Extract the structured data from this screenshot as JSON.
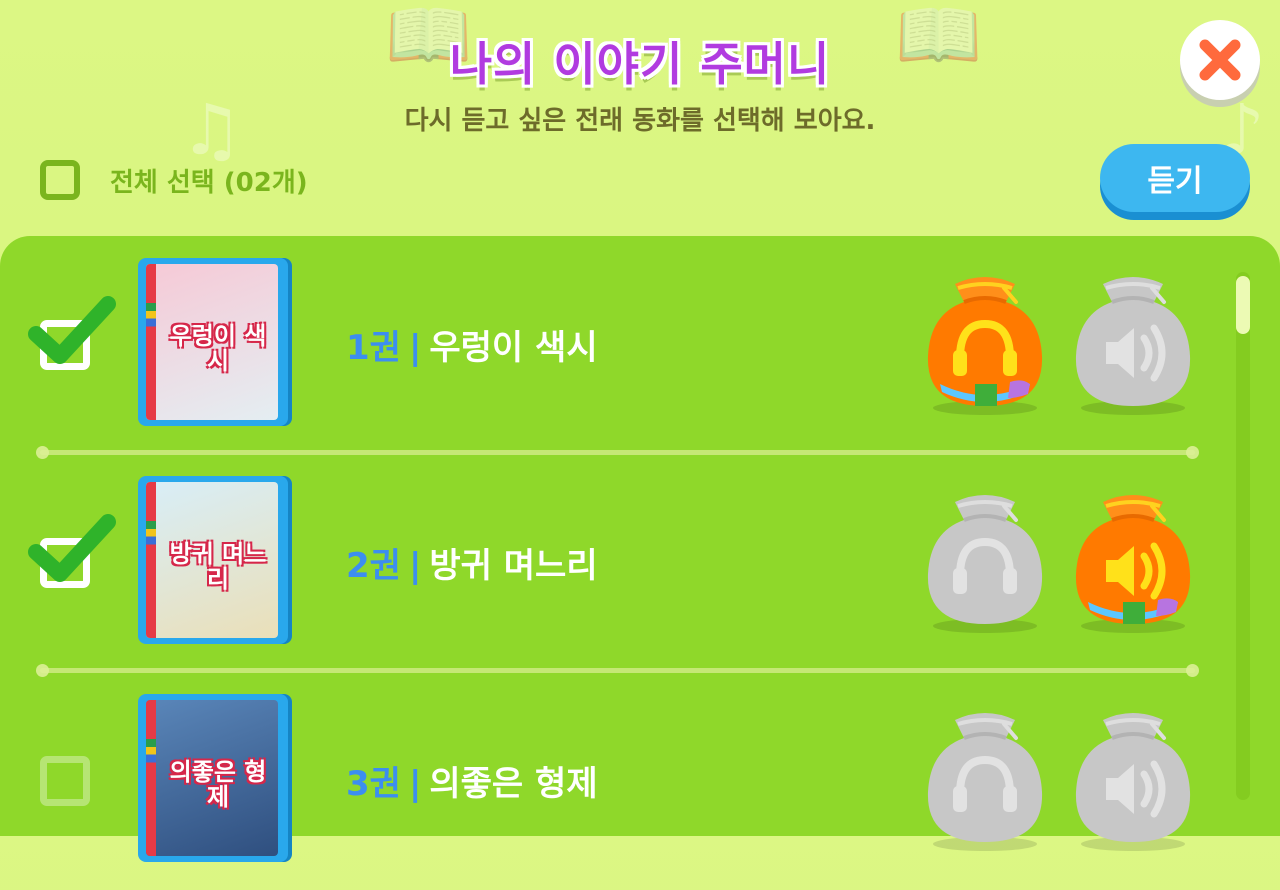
{
  "header": {
    "title": "나의 이야기 주머니",
    "subtitle": "다시 듣고 싶은 전래 동화를 선택해 보아요."
  },
  "toolbar": {
    "select_all_label": "전체 선택 (02개)",
    "select_all_checked": false,
    "listen_label": "듣기"
  },
  "colors": {
    "background": "#d6f47e",
    "panel": "#8fd82a",
    "title": "#b13be0",
    "listen_button": "#3db7f0",
    "close_x": "#ff6a3d",
    "active_bag": "#ff7a00",
    "inactive_bag": "#c7c7c7",
    "volume_number": "#3c8ef0"
  },
  "books": [
    {
      "volume": "1권",
      "title": "우렁이 색시",
      "cover_title": "우렁이 색시",
      "checked": true,
      "listen_active": true,
      "read_active": false,
      "cover_colors": [
        "#f6c9d6",
        "#e4eef2"
      ]
    },
    {
      "volume": "2권",
      "title": "방귀 며느리",
      "cover_title": "방귀 며느리",
      "checked": true,
      "listen_active": false,
      "read_active": true,
      "cover_colors": [
        "#d8eef8",
        "#eadfb8"
      ]
    },
    {
      "volume": "3권",
      "title": "의좋은 형제",
      "cover_title": "의좋은 형제",
      "checked": false,
      "listen_active": false,
      "read_active": false,
      "cover_colors": [
        "#5a86b9",
        "#2f4f7f"
      ]
    }
  ],
  "icons": {
    "close": "close-icon",
    "listen_bag": "headphones-icon",
    "read_bag": "speaker-icon",
    "check": "checkmark-icon"
  }
}
